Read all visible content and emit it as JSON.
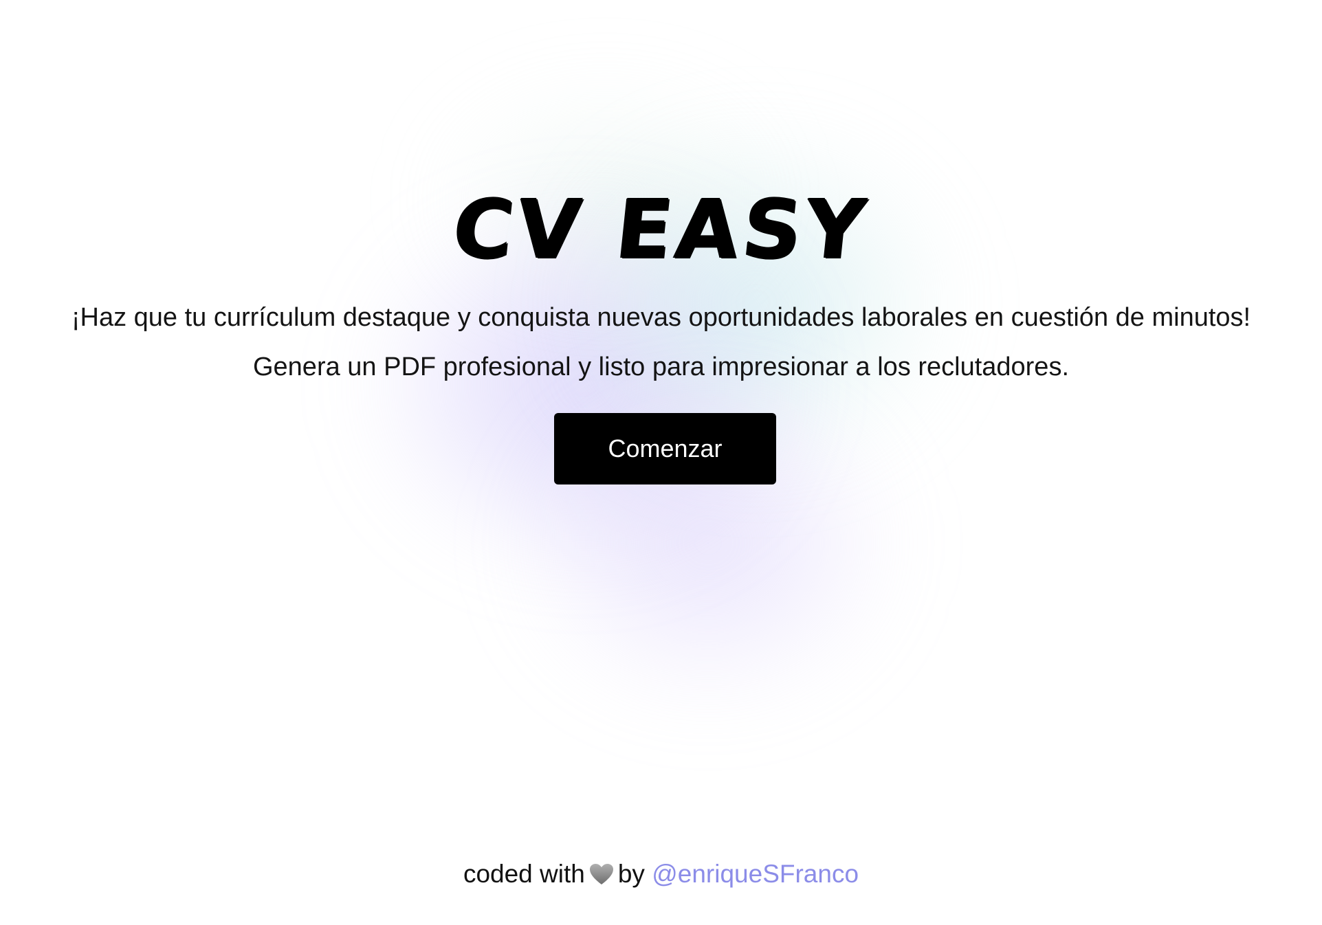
{
  "hero": {
    "title": "CV EASY",
    "tagline_line1": "¡Haz que tu currículum destaque y conquista nuevas oportunidades laborales en cuestión de minutos!",
    "tagline_line2": "Genera un PDF profesional y listo para impresionar a los reclutadores.",
    "start_button_label": "Comenzar"
  },
  "footer": {
    "prefix": "coded with",
    "heart_icon": "grey-heart-icon",
    "by": "by",
    "author_link": "@enriqueSFranco"
  },
  "colors": {
    "button_bg": "#000000",
    "button_text": "#ffffff",
    "link": "#8b8ce8",
    "glow_violet": "#c4baf8",
    "glow_teal": "#bee2ec"
  }
}
